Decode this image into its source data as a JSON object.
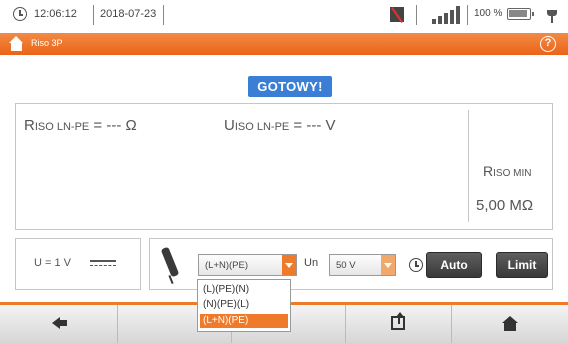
{
  "status_bar": {
    "time": "12:06:12",
    "date": "2018-07-23",
    "battery": "100 %"
  },
  "title_bar": {
    "title": "Riso 3P",
    "help_symbol": "?"
  },
  "status_badge": "GOTOWY!",
  "results": {
    "riso_label": "R",
    "riso_label_sub": "ISO LN-PE",
    "riso_value": " = --- Ω",
    "uiso_label": "U",
    "uiso_label_sub": "ISO LN-PE",
    "uiso_value": " = --- V",
    "riso_min_label": "R",
    "riso_min_sub": "ISO MIN",
    "riso_min_value": "5,00 MΩ"
  },
  "voltage_panel": {
    "label": "U = 1 V"
  },
  "controls": {
    "leads_selected": "(L+N)(PE)",
    "un_label": "Un",
    "voltage_selected": "50 V",
    "auto_label": "Auto",
    "limit_label": "Limit"
  },
  "dropdown": {
    "options": [
      "(L)(PE)(N)",
      "(N)(PE)(L)",
      "(L+N)(PE)"
    ],
    "selected_index": 2
  },
  "icons": {
    "clock": "clock-icon",
    "warning": "warning-icon",
    "signal": "signal-icon",
    "battery": "battery-icon",
    "power": "plug-icon",
    "home": "home-icon",
    "help": "help-icon",
    "probe": "probe-icon",
    "timer": "timer-icon",
    "back": "back-arrow-icon",
    "export": "export-icon"
  },
  "colors": {
    "accent": "#ee7a2a",
    "badge": "#3a7fd5",
    "button": "#444444"
  }
}
